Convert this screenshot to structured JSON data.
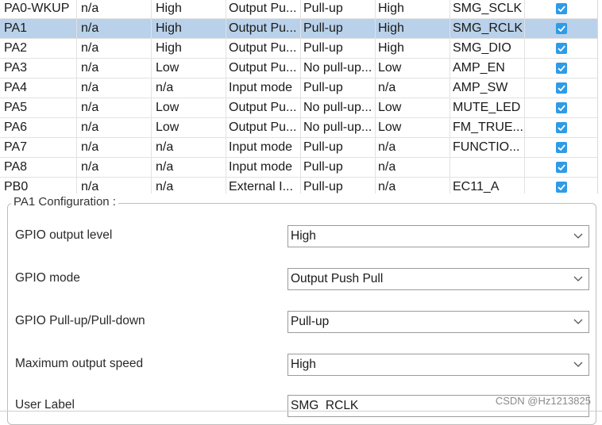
{
  "rows": [
    {
      "pin": "PA0-WKUP",
      "out_level": "n/a",
      "speed_user": "High",
      "mode": "Output Pu...",
      "pull": "Pull-up",
      "speed": "High",
      "label": "SMG_SCLK",
      "checked": true,
      "selected": false
    },
    {
      "pin": "PA1",
      "out_level": "n/a",
      "speed_user": "High",
      "mode": "Output Pu...",
      "pull": "Pull-up",
      "speed": "High",
      "label": "SMG_RCLK",
      "checked": true,
      "selected": true
    },
    {
      "pin": "PA2",
      "out_level": "n/a",
      "speed_user": "High",
      "mode": "Output Pu...",
      "pull": "Pull-up",
      "speed": "High",
      "label": "SMG_DIO",
      "checked": true,
      "selected": false
    },
    {
      "pin": "PA3",
      "out_level": "n/a",
      "speed_user": "Low",
      "mode": "Output Pu...",
      "pull": "No pull-up...",
      "speed": "Low",
      "label": "AMP_EN",
      "checked": true,
      "selected": false
    },
    {
      "pin": "PA4",
      "out_level": "n/a",
      "speed_user": "n/a",
      "mode": "Input mode",
      "pull": "Pull-up",
      "speed": "n/a",
      "label": "AMP_SW",
      "checked": true,
      "selected": false
    },
    {
      "pin": "PA5",
      "out_level": "n/a",
      "speed_user": "Low",
      "mode": "Output Pu...",
      "pull": "No pull-up...",
      "speed": "Low",
      "label": "MUTE_LED",
      "checked": true,
      "selected": false
    },
    {
      "pin": "PA6",
      "out_level": "n/a",
      "speed_user": "Low",
      "mode": "Output Pu...",
      "pull": "No pull-up...",
      "speed": "Low",
      "label": "FM_TRUE...",
      "checked": true,
      "selected": false
    },
    {
      "pin": "PA7",
      "out_level": "n/a",
      "speed_user": "n/a",
      "mode": "Input mode",
      "pull": "Pull-up",
      "speed": "n/a",
      "label": "FUNCTIO...",
      "checked": true,
      "selected": false
    },
    {
      "pin": "PA8",
      "out_level": "n/a",
      "speed_user": "n/a",
      "mode": "Input mode",
      "pull": "Pull-up",
      "speed": "n/a",
      "label": "",
      "checked": true,
      "selected": false
    },
    {
      "pin": "PB0",
      "out_level": "n/a",
      "speed_user": "n/a",
      "mode": "External I...",
      "pull": "Pull-up",
      "speed": "n/a",
      "label": "EC11_A",
      "checked": true,
      "selected": false
    }
  ],
  "config": {
    "title": "PA1 Configuration :",
    "fields": [
      {
        "label": "GPIO output level",
        "value": "High"
      },
      {
        "label": "GPIO mode",
        "value": "Output Push Pull"
      },
      {
        "label": "GPIO Pull-up/Pull-down",
        "value": "Pull-up"
      },
      {
        "label": "Maximum output speed",
        "value": "High"
      }
    ],
    "user_label": {
      "label": "User Label",
      "value": "SMG_RCLK"
    }
  },
  "watermark": "CSDN @Hz1213825",
  "colors": {
    "selected_row": "#b9d1ea",
    "checkbox": "#2e9be6"
  },
  "icons": {
    "checkbox": "checkbox-checked-icon",
    "dropdown": "chevron-down-icon"
  }
}
